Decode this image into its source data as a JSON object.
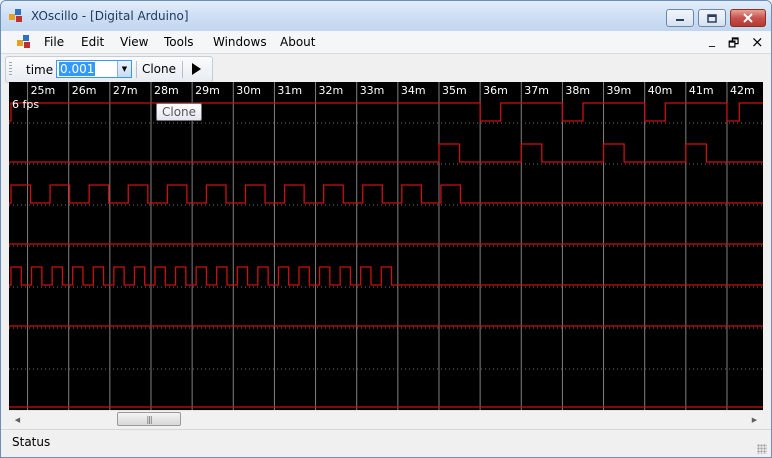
{
  "window": {
    "title": "XOscillo - [Digital Arduino]",
    "minimize_icon": "minimize-icon",
    "maximize_icon": "maximize-icon",
    "close_icon": "close-icon"
  },
  "menu": {
    "items": [
      {
        "label": "File"
      },
      {
        "label": "Edit"
      },
      {
        "label": "View"
      },
      {
        "label": "Tools"
      },
      {
        "label": "Windows"
      },
      {
        "label": "About"
      }
    ],
    "mdi_minimize": "_",
    "mdi_restore": "🗗",
    "mdi_close": "×"
  },
  "toolbar": {
    "time_label": "time",
    "time_value": "0.001",
    "clone_label": "Clone",
    "play_icon": "play-icon"
  },
  "scope": {
    "fps": "6 fps",
    "tooltip": "Clone",
    "time_ticks": [
      "25m",
      "26m",
      "27m",
      "28m",
      "29m",
      "30m",
      "31m",
      "32m",
      "33m",
      "34m",
      "35m",
      "36m",
      "37m",
      "38m",
      "39m",
      "40m",
      "41m",
      "42m"
    ],
    "colors": {
      "signal": "#cc1111",
      "grid": "#808080",
      "label": "#ffffff",
      "background": "#000000"
    },
    "channels": [
      {
        "low_between": [
          [
            "36m",
            "36.5m"
          ],
          [
            "38m",
            "38.5m"
          ],
          [
            "40m",
            "40.5m"
          ],
          [
            "42m",
            "42.3m"
          ]
        ]
      },
      {
        "pulses": [
          "35m",
          "37m",
          "39m",
          "41m"
        ]
      },
      {
        "square_wave_until": "36m"
      },
      {
        "flat": true
      },
      {
        "square_wave_until": "34m"
      },
      {
        "flat": true
      },
      {
        "flat": true
      }
    ]
  },
  "status": {
    "text": "Status"
  }
}
